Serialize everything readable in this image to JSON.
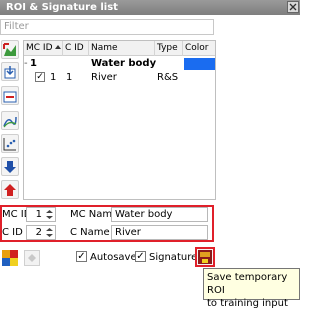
{
  "window": {
    "title": "ROI & Signature list"
  },
  "filter": {
    "placeholder": "Filter"
  },
  "table": {
    "headers": {
      "mc_id": "MC ID",
      "c_id": "C ID",
      "name": "Name",
      "type": "Type",
      "color": "Color"
    },
    "group_row": {
      "mc_id": "1",
      "name": "Water body",
      "color": "#1a6cf0"
    },
    "rows": [
      {
        "checked": "✓",
        "mc_id": "1",
        "c_id": "1",
        "name": "River",
        "type": "R&S"
      }
    ]
  },
  "fields": {
    "mc_id_label": "MC ID",
    "mc_id_value": "1",
    "mc_name_label": "MC Name",
    "mc_name_value": "Water body",
    "c_id_label": "C ID",
    "c_id_value": "2",
    "c_name_label": "C Name",
    "c_name_value": "River"
  },
  "options": {
    "autosave_label": "Autosave",
    "autosave_checked": "✓",
    "signature_label": "Signature",
    "signature_checked": "✓"
  },
  "tooltip": {
    "line1": "Save temporary ROI",
    "line2": "to training input"
  },
  "colors": {
    "highlight": "#e0202a",
    "group_color": "#1a6cf0"
  }
}
